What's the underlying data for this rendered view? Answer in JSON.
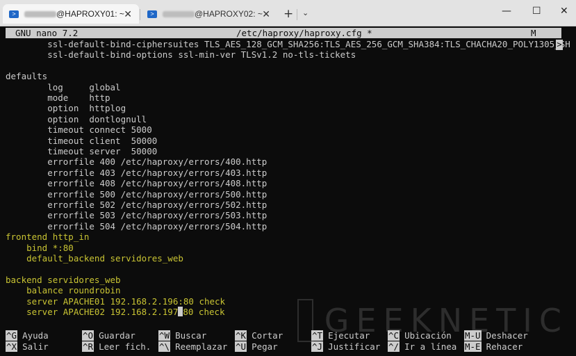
{
  "window": {
    "tabs": [
      {
        "title": "@HAPROXY01: ~",
        "close": "✕",
        "active": true
      },
      {
        "title": "@HAPROXY02: ~",
        "close": "✕",
        "active": false
      }
    ],
    "new_tab": "+",
    "dropdown": "⌄",
    "minimize": "—",
    "maximize": "☐",
    "close": "✕"
  },
  "nano": {
    "version": "GNU nano 7.2",
    "filename": "/etc/haproxy/haproxy.cfg *",
    "modified_flag": "M",
    "overflow_marker": ">"
  },
  "lines": [
    {
      "text": "        ssl-default-bind-ciphersuites TLS_AES_128_GCM_SHA256:TLS_AES_256_GCM_SHA384:TLS_CHACHA20_POLY1305_SH",
      "color": "white"
    },
    {
      "text": "        ssl-default-bind-options ssl-min-ver TLSv1.2 no-tls-tickets",
      "color": "white"
    },
    {
      "text": "",
      "color": "white"
    },
    {
      "text": "defaults",
      "color": "white"
    },
    {
      "text": "        log     global",
      "color": "white"
    },
    {
      "text": "        mode    http",
      "color": "white"
    },
    {
      "text": "        option  httplog",
      "color": "white"
    },
    {
      "text": "        option  dontlognull",
      "color": "white"
    },
    {
      "text": "        timeout connect 5000",
      "color": "white"
    },
    {
      "text": "        timeout client  50000",
      "color": "white"
    },
    {
      "text": "        timeout server  50000",
      "color": "white"
    },
    {
      "text": "        errorfile 400 /etc/haproxy/errors/400.http",
      "color": "white"
    },
    {
      "text": "        errorfile 403 /etc/haproxy/errors/403.http",
      "color": "white"
    },
    {
      "text": "        errorfile 408 /etc/haproxy/errors/408.http",
      "color": "white"
    },
    {
      "text": "        errorfile 500 /etc/haproxy/errors/500.http",
      "color": "white"
    },
    {
      "text": "        errorfile 502 /etc/haproxy/errors/502.http",
      "color": "white"
    },
    {
      "text": "        errorfile 503 /etc/haproxy/errors/503.http",
      "color": "white"
    },
    {
      "text": "        errorfile 504 /etc/haproxy/errors/504.http",
      "color": "white"
    },
    {
      "text": "frontend http_in",
      "color": "yellow"
    },
    {
      "text": "    bind *:80",
      "color": "yellow"
    },
    {
      "text": "    default_backend servidores_web",
      "color": "yellow"
    },
    {
      "text": "",
      "color": "yellow"
    },
    {
      "text": "backend servidores_web",
      "color": "yellow"
    },
    {
      "text": "    balance roundrobin",
      "color": "yellow"
    },
    {
      "text": "    server APACHE01 192.168.2.196:80 check",
      "color": "yellow"
    },
    {
      "text": "    server APACHE02 192.168.2.197",
      "color": "yellow",
      "after_cursor": "80 check"
    }
  ],
  "shortcuts": [
    {
      "key": "^G",
      "label": "Ayuda"
    },
    {
      "key": "^O",
      "label": "Guardar"
    },
    {
      "key": "^W",
      "label": "Buscar"
    },
    {
      "key": "^K",
      "label": "Cortar"
    },
    {
      "key": "^T",
      "label": "Ejecutar"
    },
    {
      "key": "^C",
      "label": "Ubicación"
    },
    {
      "key": "M-U",
      "label": "Deshacer"
    },
    {
      "key": "^X",
      "label": "Salir"
    },
    {
      "key": "^R",
      "label": "Leer fich."
    },
    {
      "key": "^\\",
      "label": "Reemplazar"
    },
    {
      "key": "^U",
      "label": "Pegar"
    },
    {
      "key": "^J",
      "label": "Justificar"
    },
    {
      "key": "^/",
      "label": "Ir a línea"
    },
    {
      "key": "M-E",
      "label": "Rehacer"
    }
  ],
  "watermark": "GEEKNETIC",
  "colors": {
    "terminal_bg": "#0c0c0c",
    "text": "#cccccc",
    "highlight": "#c9c433",
    "accent_icon": "#1f67c7"
  }
}
